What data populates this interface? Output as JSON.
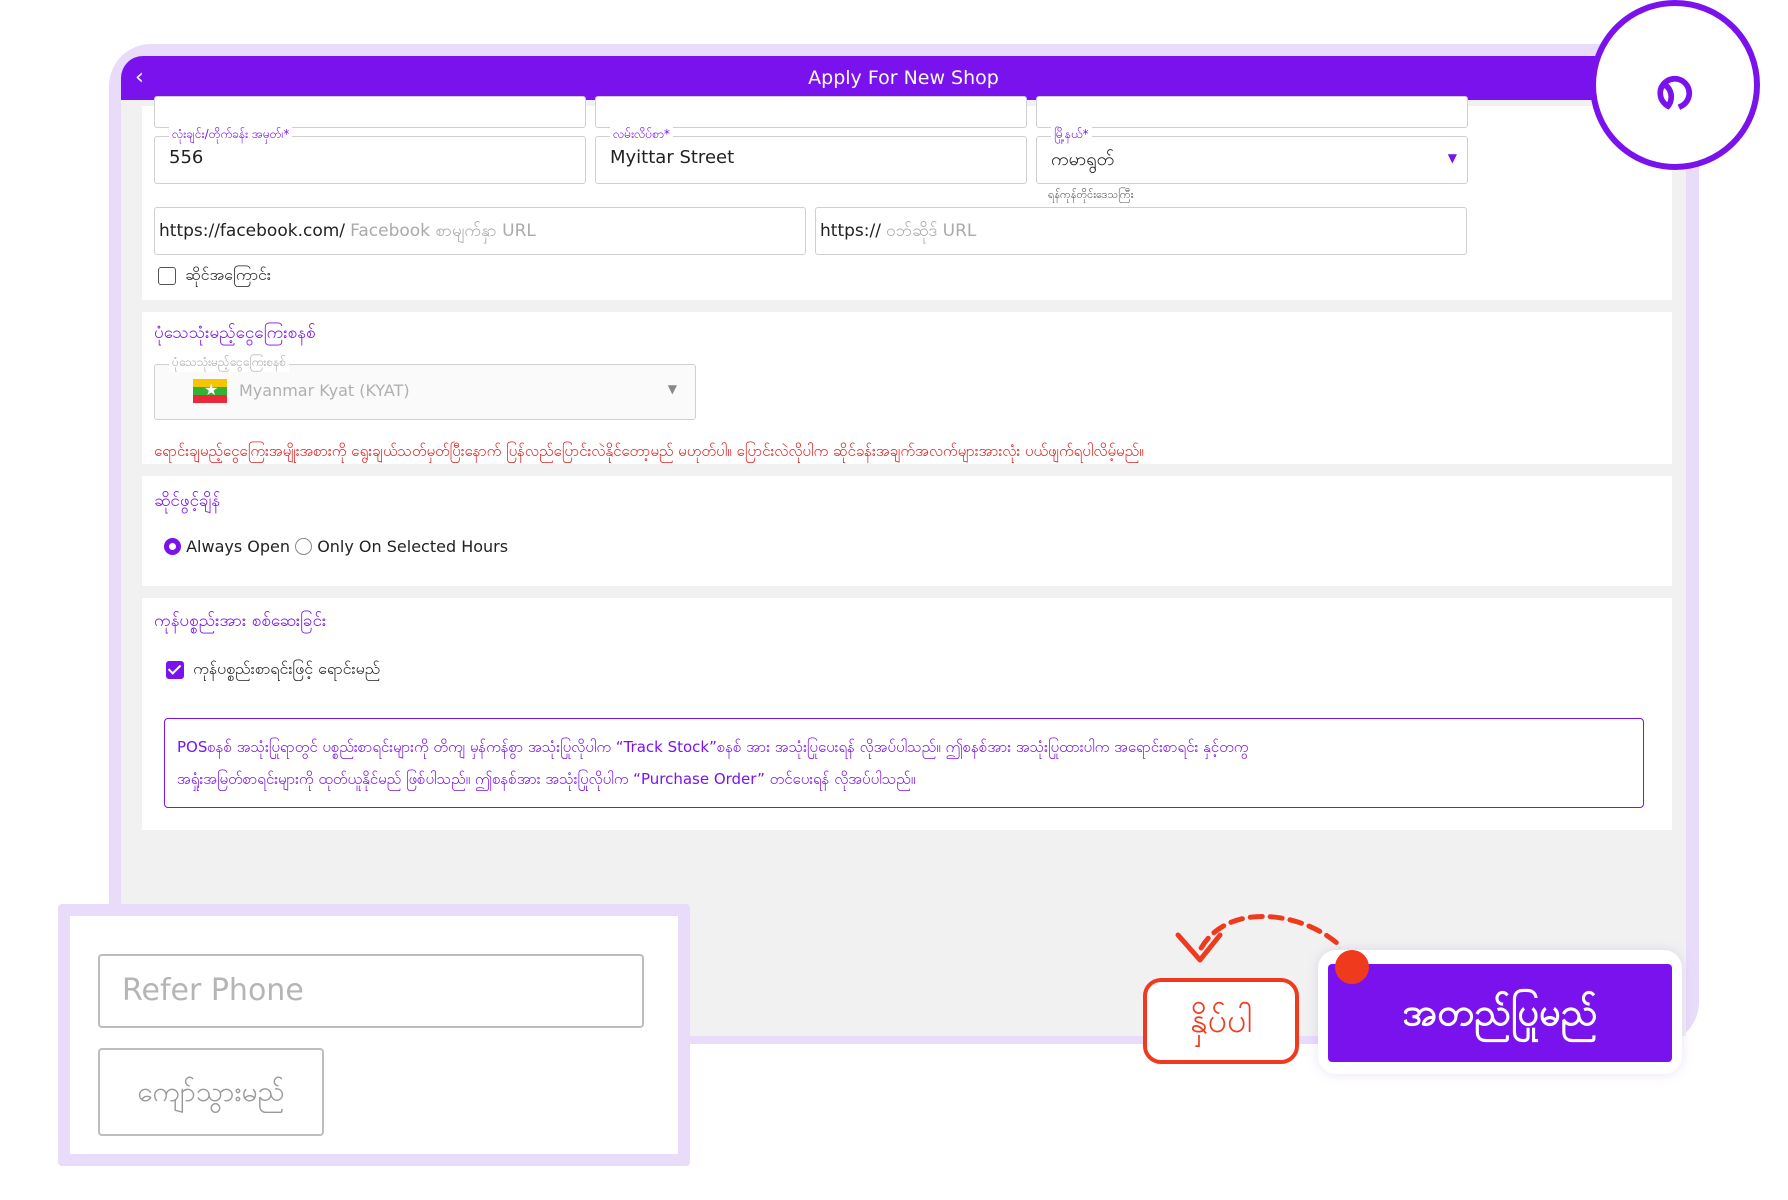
{
  "window": {
    "title": "Apply For New Shop"
  },
  "address": {
    "building_label": "လုံးချင်း/တိုက်ခန်း အမှတ်၊*",
    "building_value": "556",
    "street_label": "လမ်းလိပ်စာ*",
    "street_value": "Myittar Street",
    "township_label": "မြို့နယ်*",
    "township_value": "ကမာရွတ်",
    "region_hint": "ရန်ကုန်တိုင်းဒေသကြီး"
  },
  "links": {
    "facebook_prefix": "https://facebook.com/",
    "facebook_placeholder": "Facebook စာမျက်နှာ URL",
    "website_prefix": "https://",
    "website_placeholder": "ဝဘ်ဆိုဒ် URL",
    "closed_label": "ဆိုင်အကြောင်း"
  },
  "currency": {
    "section_title": "ပုံသေသုံးမည့်ငွေကြေးစနစ်",
    "field_label": "ပုံသေသုံးမည့်ငွေကြေးစနစ်",
    "selected": "Myanmar Kyat (KYAT)",
    "warning": "ရောင်းချမည့်ငွေကြေးအမျိုးအစားကို ရွေးချယ်သတ်မှတ်ပြီးနောက် ပြန်လည်ပြောင်းလဲနိုင်တော့မည် မဟုတ်ပါ။ ပြောင်းလဲလိုပါက ဆိုင်ခန်းအချက်အလက်များအားလုံး ပယ်ဖျက်ရပါလိမ့်မည်။"
  },
  "hours": {
    "section_title": "ဆိုင်ဖွင့်ချိန်",
    "option_always": "Always Open",
    "option_selected": "Only On Selected Hours"
  },
  "stock": {
    "section_title": "ကုန်ပစ္စည်းအား စစ်ဆေးခြင်း",
    "checkbox_label": "ကုန်ပစ္စည်းစာရင်းဖြင့် ရောင်းမည်",
    "note_line1": "POSစနစ် အသုံးပြုရာတွင် ပစ္စည်းစာရင်းများကို တိကျ မှန်ကန်စွာ  အသုံးပြုလိုပါက “Track Stock”စနစ် အား အသုံးပြုပေးရန် လိုအပ်ပါသည်။ ဤစနစ်အား အသုံးပြုထားပါက အရောင်းစာရင်း နှင့်တကွ",
    "note_line2": "အရှုံးအမြတ်စာရင်းများကို ထုတ်ယူနိုင်မည် ဖြစ်ပါသည်။ ဤစနစ်အား အသုံးပြုလိုပါက “Purchase Order” တင်ပေးရန် လိုအပ်ပါသည်။"
  },
  "refer": {
    "phone_placeholder": "Refer Phone",
    "skip_label": "ကျော်သွားမည်"
  },
  "actions": {
    "confirm_label": "အတည်ပြုမည်",
    "press_hint": "နှိပ်ပါ"
  },
  "step_badge": "၈",
  "colors": {
    "accent": "#7a12ee",
    "warning": "#e02020",
    "hint": "#f03a1e"
  }
}
